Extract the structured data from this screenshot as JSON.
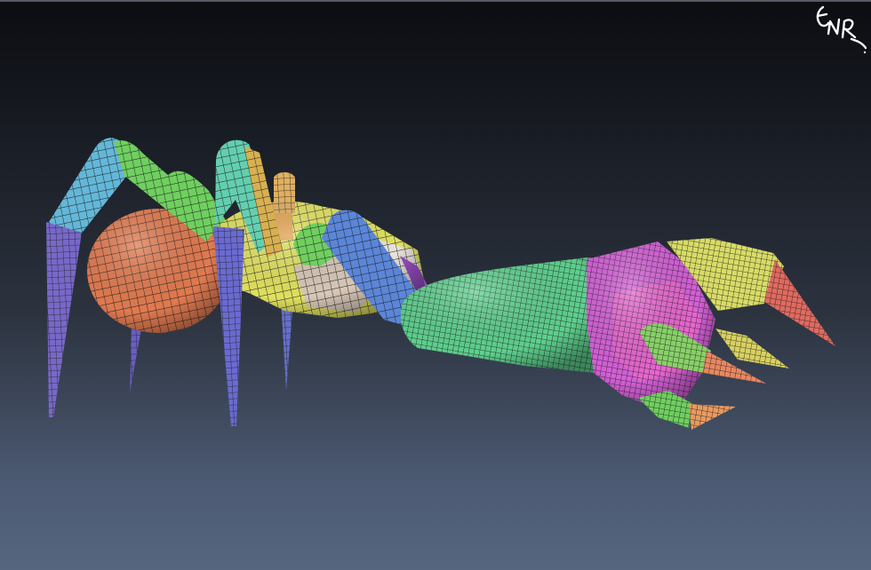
{
  "scene": {
    "subject": "",
    "watermark_text": "ENR",
    "icons": [
      "signature-logo-icon"
    ],
    "colors": {
      "background_top": "#0c0d11",
      "background_bottom": "#56667f",
      "wire": "#1c1c1c",
      "sphere": "#e07a50",
      "leg_upper": "#63b7d8",
      "leg_lower": "#7868c8",
      "leg_joint": "#6fcf5f",
      "body_yellow": "#e0e060",
      "arm_green": "#5ed08e",
      "arm_blue": "#5b86d8",
      "hand_magenta": "#d560d8",
      "claw_yellow": "#d8dc66",
      "claw_tip_red": "#e06a60",
      "claw_green": "#88d068",
      "claw_orange": "#e89a60"
    }
  }
}
